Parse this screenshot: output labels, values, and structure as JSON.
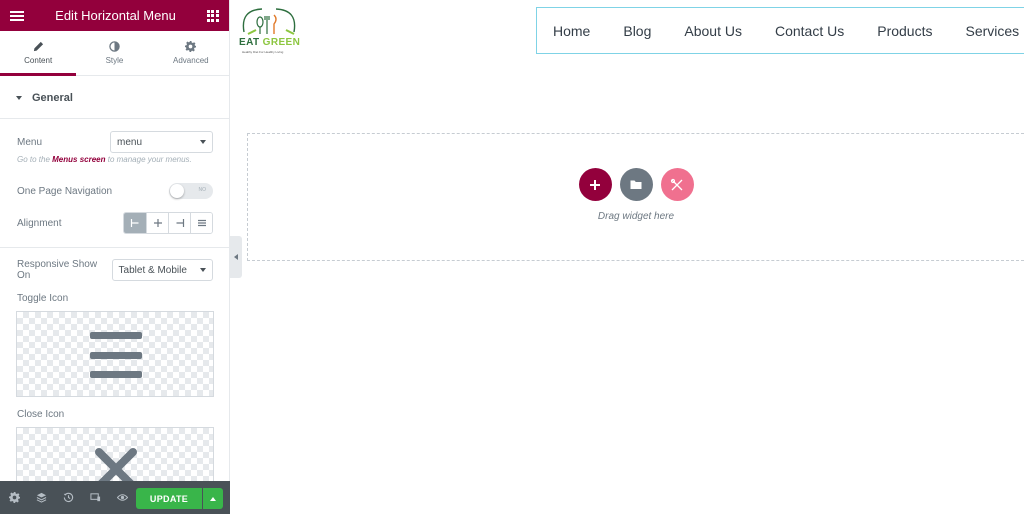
{
  "panel": {
    "title": "Edit Horizontal Menu",
    "tabs": [
      {
        "label": "Content",
        "icon": "pencil-icon"
      },
      {
        "label": "Style",
        "icon": "contrast-icon"
      },
      {
        "label": "Advanced",
        "icon": "gear-icon"
      }
    ],
    "section_title": "General",
    "menu_label": "Menu",
    "menu_value": "menu",
    "hint_prefix": "Go to the ",
    "hint_link": "Menus screen",
    "hint_suffix": " to manage your menus.",
    "one_page_label": "One Page Navigation",
    "toggle_text": "NO",
    "alignment_label": "Alignment",
    "responsive_label": "Responsive Show On",
    "responsive_value": "Tablet & Mobile",
    "toggle_icon_label": "Toggle Icon",
    "close_icon_label": "Close Icon",
    "update_label": "UPDATE"
  },
  "logo": {
    "word1": "EAT ",
    "word2": "GREEN",
    "tagline": "Healthy Diet For Healthy Living"
  },
  "nav": {
    "items": [
      "Home",
      "Blog",
      "About Us",
      "Contact Us",
      "Products",
      "Services"
    ]
  },
  "dropzone": {
    "label": "Drag widget here"
  },
  "colors": {
    "brand": "#93003c",
    "update": "#39b54a",
    "nav_border": "#7fd3e6"
  }
}
